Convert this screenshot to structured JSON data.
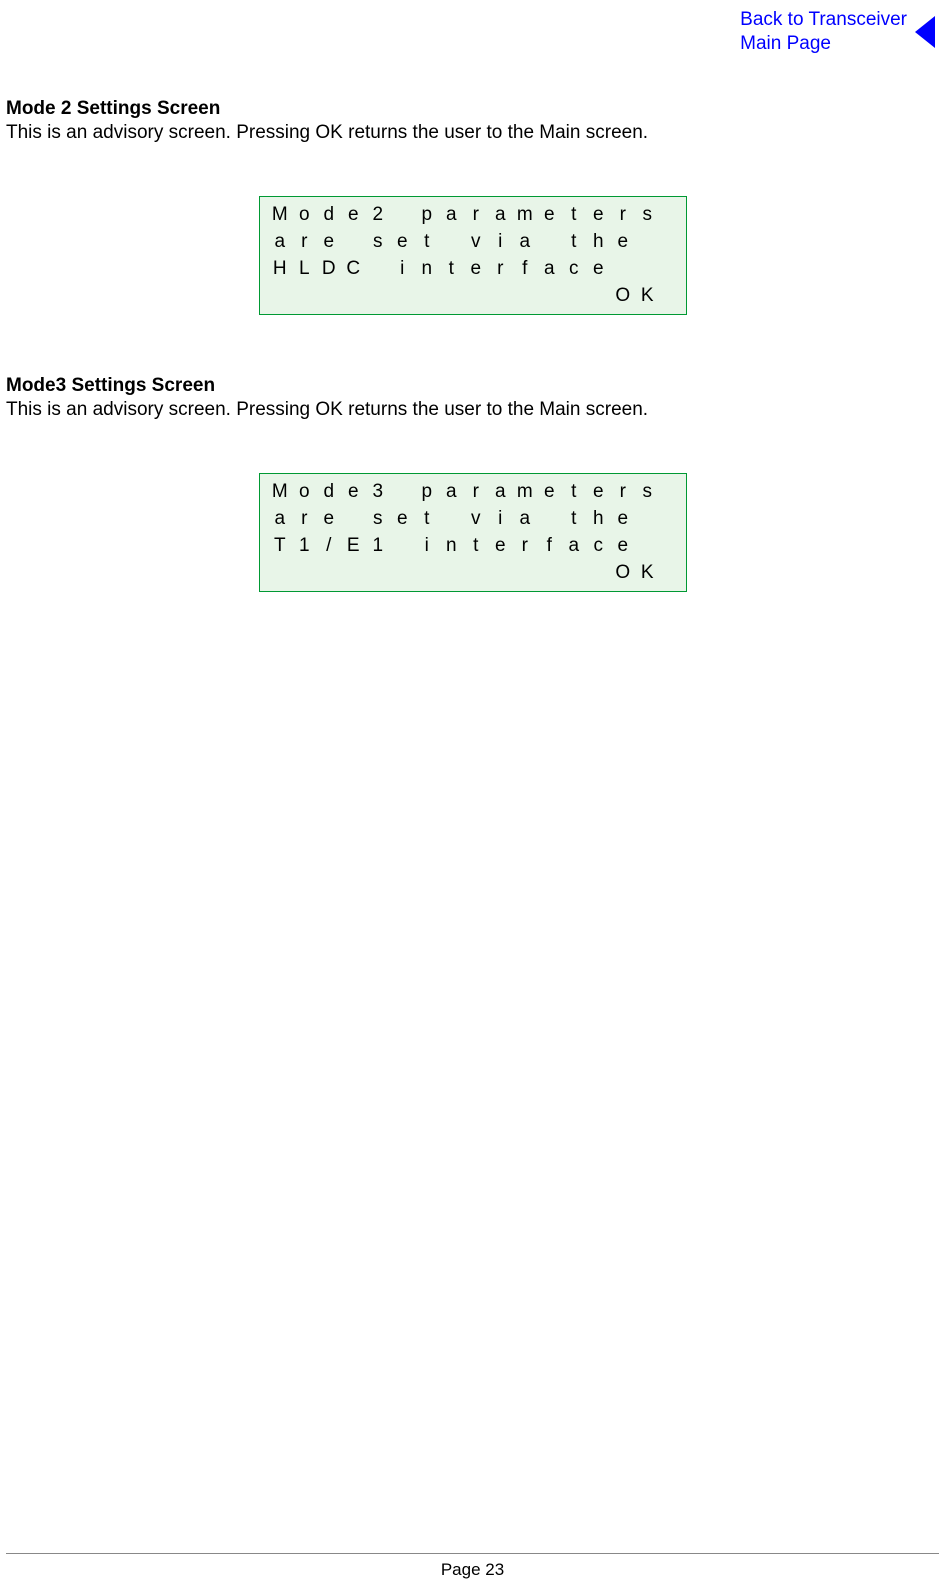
{
  "header": {
    "link_line1": "Back to Transceiver",
    "link_line2": "Main Page"
  },
  "sections": [
    {
      "heading": "Mode 2 Settings Screen",
      "body": "This is an advisory screen. Pressing OK returns the user to the Main screen.",
      "lcd": {
        "rows": [
          [
            "M",
            "o",
            "d",
            "e",
            "2",
            " ",
            "p",
            "a",
            "r",
            "a",
            "m",
            "e",
            "t",
            "e",
            "r",
            "s"
          ],
          [
            "a",
            "r",
            "e",
            " ",
            "s",
            "e",
            "t",
            " ",
            "v",
            "i",
            "a",
            " ",
            "t",
            "h",
            "e",
            " "
          ],
          [
            "H",
            "L",
            "D",
            "C",
            " ",
            "i",
            "n",
            "t",
            "e",
            "r",
            "f",
            "a",
            "c",
            "e",
            " ",
            " "
          ],
          [
            " ",
            " ",
            " ",
            " ",
            " ",
            " ",
            " ",
            " ",
            " ",
            " ",
            " ",
            " ",
            " ",
            " ",
            "O",
            "K"
          ]
        ],
        "ok_label": "OK"
      }
    },
    {
      "heading": "Mode3 Settings Screen",
      "body": "This is an advisory screen. Pressing OK returns the user to the Main screen.",
      "lcd": {
        "rows": [
          [
            "M",
            "o",
            "d",
            "e",
            "3",
            " ",
            "p",
            "a",
            "r",
            "a",
            "m",
            "e",
            "t",
            "e",
            "r",
            "s"
          ],
          [
            "a",
            "r",
            "e",
            " ",
            "s",
            "e",
            "t",
            " ",
            "v",
            "i",
            "a",
            " ",
            "t",
            "h",
            "e",
            " "
          ],
          [
            "T",
            "1",
            "/",
            "E",
            "1",
            " ",
            "i",
            "n",
            "t",
            "e",
            "r",
            "f",
            "a",
            "c",
            "e",
            " "
          ],
          [
            " ",
            " ",
            " ",
            " ",
            " ",
            " ",
            " ",
            " ",
            " ",
            " ",
            " ",
            " ",
            " ",
            " ",
            "O",
            "K"
          ]
        ],
        "ok_label": "OK"
      }
    }
  ],
  "footer": {
    "page": "Page 23"
  }
}
